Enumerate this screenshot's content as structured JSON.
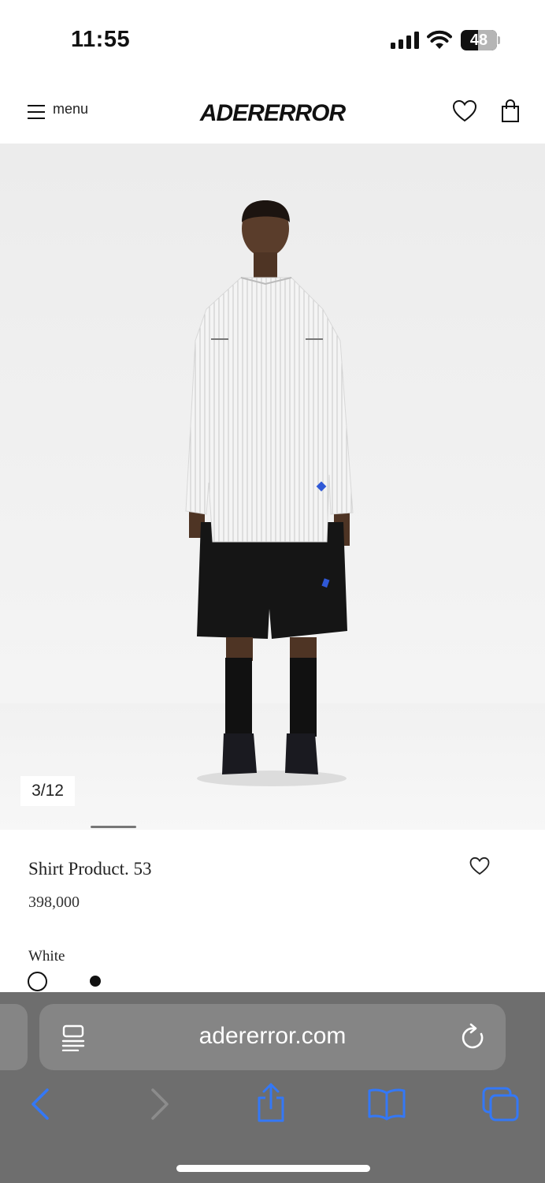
{
  "status_bar": {
    "time": "11:55",
    "battery_level": "48",
    "battery_fraction": 0.48
  },
  "header": {
    "menu_label": "menu",
    "logo_text": "ADERERROR",
    "icons": [
      "menu-icon",
      "heart-icon",
      "shopping-bag-icon"
    ]
  },
  "gallery": {
    "counter": "3/12",
    "current_index": 3,
    "total_images": 12
  },
  "product": {
    "name": "Shirt Product. 53",
    "price": "398,000",
    "color_label": "White",
    "swatches": [
      "white",
      "black"
    ],
    "selected_swatch": "white"
  },
  "browser": {
    "url": "adererror.com",
    "icons": [
      "reader-icon",
      "reload-icon",
      "back-icon",
      "forward-icon",
      "share-icon",
      "bookmarks-icon",
      "tabs-icon"
    ]
  },
  "colors": {
    "accent": "#3478f6",
    "toolbar": "#6e6e6e",
    "url_bar": "#858585",
    "text": "#111111"
  }
}
